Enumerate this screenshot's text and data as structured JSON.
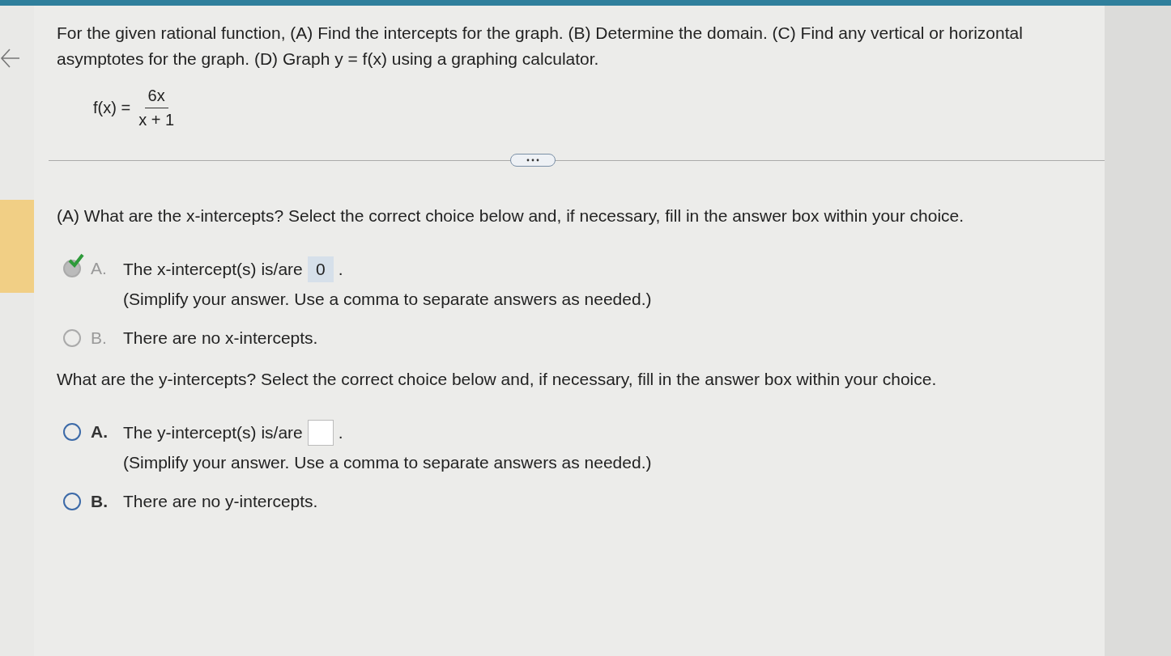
{
  "problem": {
    "text": "For the given rational function, (A) Find the intercepts for the graph. (B) Determine the domain. (C) Find any vertical or horizontal asymptotes for the graph. (D) Graph y = f(x) using a graphing calculator.",
    "function_label": "f(x) =",
    "numerator": "6x",
    "denominator": "x + 1"
  },
  "questions": [
    {
      "prompt": "(A) What are the x-intercepts? Select the correct choice below and, if necessary, fill in the answer box within your choice.",
      "locked": true,
      "choices": [
        {
          "letter": "A.",
          "kind": "answer",
          "before": "The x-intercept(s) is/are",
          "value": "0",
          "after": ".",
          "hint": "(Simplify your answer. Use a comma to separate answers as needed.)",
          "selected": true
        },
        {
          "letter": "B.",
          "kind": "text",
          "text": "There are no x-intercepts.",
          "selected": false
        }
      ]
    },
    {
      "prompt": "What are the y-intercepts? Select the correct choice below and, if necessary, fill in the answer box within your choice.",
      "locked": false,
      "choices": [
        {
          "letter": "A.",
          "kind": "answer",
          "before": "The y-intercept(s) is/are",
          "after": ".",
          "hint": "(Simplify your answer. Use a comma to separate answers as needed.)",
          "selected": false
        },
        {
          "letter": "B.",
          "kind": "text",
          "text": "There are no y-intercepts.",
          "selected": false
        }
      ]
    }
  ]
}
